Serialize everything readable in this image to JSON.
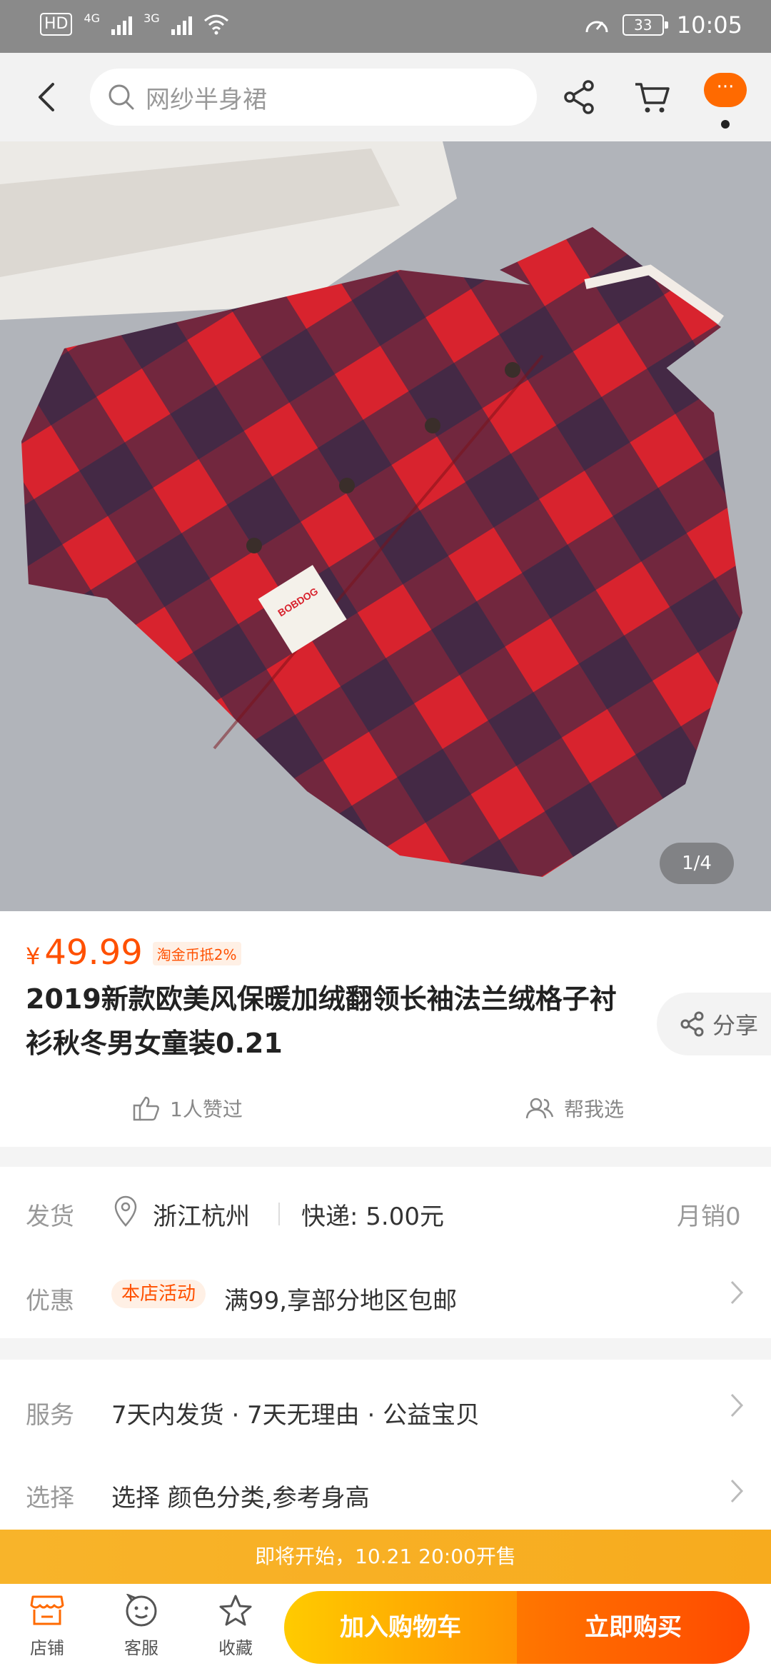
{
  "status": {
    "hd": "HD",
    "sim1": "1",
    "net1": "4G",
    "net2": "3G",
    "battery": "33",
    "time": "10:05"
  },
  "nav": {
    "search_placeholder": "网纱半身裙",
    "more_label": "···"
  },
  "gallery": {
    "counter": "1/4",
    "label_text": "BOBDOG"
  },
  "product": {
    "currency": "¥",
    "price": "49.99",
    "coin_tag": "淘金币抵2%",
    "title": "2019新款欧美风保暖加绒翻领长袖法兰绒格子衬衫秋冬男女童装0.21",
    "share_label": "分享",
    "likes": "1人赞过",
    "help_choose": "帮我选"
  },
  "delivery": {
    "label": "发货",
    "location": "浙江杭州",
    "shipping": "快递: 5.00元",
    "monthly_sales": "月销0"
  },
  "promo": {
    "label": "优惠",
    "tag": "本店活动",
    "text": "满99,享部分地区包邮"
  },
  "service": {
    "label": "服务",
    "text": "7天内发货 · 7天无理由 · 公益宝贝"
  },
  "select": {
    "label": "选择",
    "text": "选择 颜色分类,参考身高"
  },
  "banner": {
    "text": "即将开始，10.21 20:00开售"
  },
  "bottom": {
    "shop": "店铺",
    "service": "客服",
    "favorite": "收藏",
    "add_cart": "加入购物车",
    "buy_now": "立即购买"
  },
  "colors": {
    "accent": "#ff5000",
    "banner": "#f8b42a",
    "cart_button": "#ffb000",
    "buy_button": "#ff5a00"
  }
}
